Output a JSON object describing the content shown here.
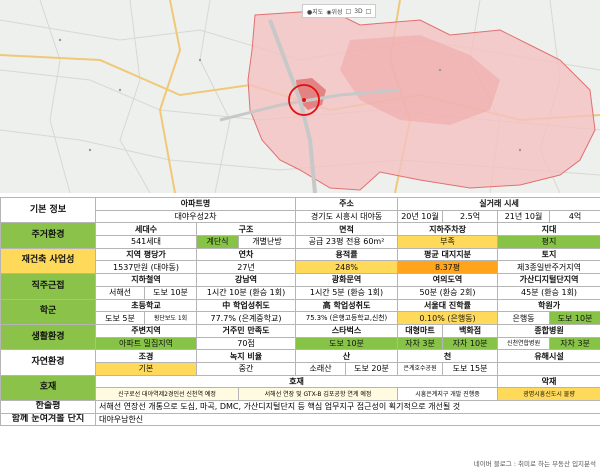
{
  "map": {
    "controls": [
      "●지도",
      "◉위성",
      "□",
      "3D",
      "□"
    ],
    "colors": {
      "district": "#f4c2c2",
      "zone": "#e07070",
      "marker": "#e01010"
    }
  },
  "table": {
    "basic_label": "기본 정보",
    "apt_name_h": "아파트명",
    "address_h": "주소",
    "market_h": "실거래 시세",
    "apt_name": "대야우성2차",
    "address": "경기도 시흥시 대야동",
    "price1_date": "20년 10월",
    "price1": "2.5억",
    "price2_date": "21년 10월",
    "price2": "4억",
    "living_label": "주거환경",
    "households_h": "세대수",
    "structure_h": "구조",
    "area_h": "면적",
    "parking_h": "지하주차장",
    "terrain_h": "지대",
    "households": "541세대",
    "structure1": "계단식",
    "structure2": "개별난방",
    "area": "공급 23평  전용 60m²",
    "parking": "부족",
    "terrain": "평지",
    "rebuild_label": "재건축 사업성",
    "pyeong_price_h": "지역 평당가",
    "age_h": "연차",
    "far_h": "용적률",
    "land_share_h": "평균 대지지분",
    "land_h": "토지",
    "pyeong_price": "1537만원 (대야동)",
    "age": "27년",
    "far": "248%",
    "land_share": "8.37평",
    "land": "제3종일반주거지역",
    "commute_label": "직주근접",
    "subway_h": "지하철역",
    "gangnam_h": "강남역",
    "gwanghwamun_h": "광화문역",
    "yeouido_h": "여의도역",
    "gasan_h": "가산디지털단지역",
    "subway1": "서해선",
    "subway2": "도보 10분",
    "gangnam": "1시간 10분 (환승 1회)",
    "gwanghwamun": "1시간 5분 (환승 1회)",
    "yeouido": "50분 (환승 2회)",
    "gasan": "45분 (환승 1회)",
    "school_label": "학군",
    "elementary_h": "초등학교",
    "middle_h": "中 학업성취도",
    "high_h": "高 학업성취도",
    "snu_h": "서울대 진학률",
    "academy_h": "학원가",
    "elementary1": "도보 5분",
    "elementary2": "횡단보도 1회",
    "middle": "77.7% (은계중학교)",
    "high": "75.3% (은행고등학교,신천)",
    "snu": "0.10% (은행동)",
    "academy1": "은행동",
    "academy2": "도보 10분",
    "life_label": "생활환경",
    "zone_h": "주변지역",
    "resident_h": "거주민 만족도",
    "starbucks_h": "스타벅스",
    "mart_h": "대형마트",
    "dept_h": "백화점",
    "hospital_h": "종합병원",
    "zone": "아파트 밀집지역",
    "resident": "70점",
    "starbucks": "도보 10분",
    "mart": "자차 3분",
    "dept": "자차 10분",
    "hospital1": "신천연합병원",
    "hospital2": "자차 3분",
    "nature_label": "자연환경",
    "view_h": "조경",
    "green_h": "녹지 비율",
    "mountain_h": "산",
    "stream_h": "천",
    "facility_h": "유해시설",
    "view": "기본",
    "green": "중간",
    "mountain1": "소래산",
    "mountain2": "도보 20분",
    "stream1": "은계호수공원",
    "stream2": "도보 15분",
    "facility": "",
    "factor_label": "호재",
    "good_h": "호재",
    "bad_h": "악재",
    "good1": "신구로선 대야역제2경인선 신천역 예정",
    "good2": "서해선 연장 및 GTX-B 김포공항 연계 예정",
    "good3": "시흥은계지구 개발 진행중",
    "bad": "광명시흥신도시 물량",
    "summary_label": "한줄평",
    "summary": "서해선 연장선 개통으로 도심, 마곡, DMC, 가산디지털단지 등 핵심 업무지구 접근성이 획기적으로 개선될 것",
    "compare_label": "함께 눈여겨볼 단지",
    "compare": "대야우남한신"
  },
  "source": "네이버 블로그 : 취미로 하는 부동산 입지분석"
}
